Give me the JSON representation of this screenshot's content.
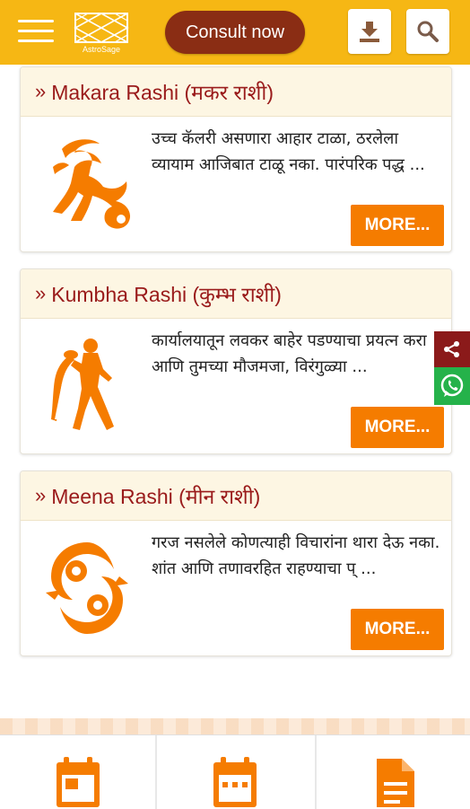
{
  "header": {
    "logo_text": "AstroSage",
    "consult_label": "Consult now"
  },
  "cards": [
    {
      "title": "Makara Rashi (मकर राशी)",
      "text": "उच्च कॅलरी असणारा आहार टाळा, ठरलेला व्यायाम आजिबात टाळू नका. पारंपरिक पद्ध ...",
      "more_label": "MORE...",
      "icon": "capricorn-sign-icon"
    },
    {
      "title": "Kumbha Rashi (कुम्भ राशी)",
      "text": "कार्यालयातून लवकर बाहेर पडण्याचा प्रयत्न करा आणि तुमच्या मौजमजा, विरंगुळ्या ...",
      "more_label": "MORE...",
      "icon": "aquarius-sign-icon"
    },
    {
      "title": "Meena Rashi (मीन राशी)",
      "text": "गरज नसलेले कोणत्याही विचारांना थारा देऊ नका. शांत आणि तणावरहित राहण्याचा प् ...",
      "more_label": "MORE...",
      "icon": "pisces-sign-icon"
    }
  ],
  "colors": {
    "topbar": "#f6b714",
    "consult": "#8a2d14",
    "card_title": "#9a1b1b",
    "more_button": "#f57c00",
    "share": "#8b1a1a",
    "whatsapp": "#25b24a",
    "sign": "#f57c00"
  },
  "bottom_nav": [
    {
      "icon": "calendar-day-icon"
    },
    {
      "icon": "calendar-grid-icon"
    },
    {
      "icon": "document-icon"
    }
  ]
}
